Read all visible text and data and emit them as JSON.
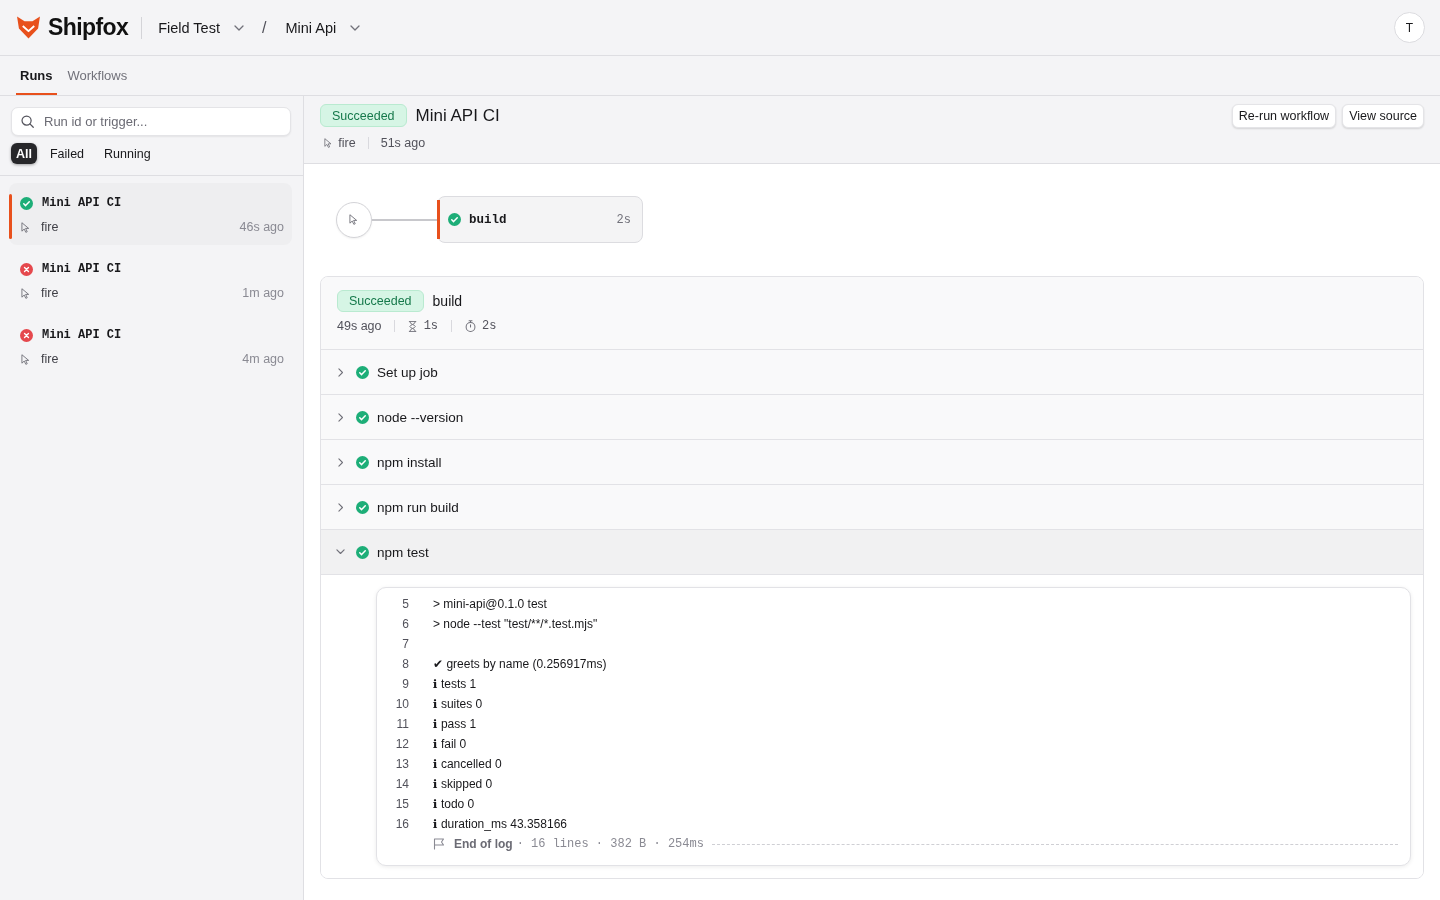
{
  "header": {
    "brand": "Shipfox",
    "breadcrumb": [
      {
        "label": "Field Test"
      },
      {
        "label": "Mini Api"
      }
    ],
    "breadcrumb_separator": "/",
    "avatar": "T"
  },
  "nav_tabs": [
    {
      "label": "Runs",
      "selected": true
    },
    {
      "label": "Workflows",
      "selected": false
    }
  ],
  "sidebar": {
    "search": {
      "placeholder": "Run id or trigger..."
    },
    "filters": [
      {
        "label": "All",
        "selected": true
      },
      {
        "label": "Failed",
        "selected": false
      },
      {
        "label": "Running",
        "selected": false
      }
    ],
    "runs": [
      {
        "title": "Mini API CI",
        "kind": "success",
        "trigger": "fire",
        "time": "46s ago",
        "selected": true
      },
      {
        "title": "Mini API CI",
        "kind": "failure",
        "trigger": "fire",
        "time": "1m ago",
        "selected": false
      },
      {
        "title": "Mini API CI",
        "kind": "failure",
        "trigger": "fire",
        "time": "4m ago",
        "selected": false
      }
    ]
  },
  "run": {
    "kind": "success",
    "status_label": "Succeeded",
    "title": "Mini API CI",
    "trigger": "fire",
    "time": "51s ago",
    "buttons": [
      "Re-run workflow",
      "View source"
    ]
  },
  "graph": {
    "jobs": [
      {
        "name": "build",
        "kind": "success",
        "duration": "2s",
        "selected": true
      }
    ]
  },
  "job": {
    "kind": "success",
    "status_label": "Succeeded",
    "name": "build",
    "time": "49s ago",
    "queued": "1s",
    "duration": "2s",
    "steps": [
      {
        "label": "Set up job",
        "kind": "success",
        "expanded": false
      },
      {
        "label": "node --version",
        "kind": "success",
        "expanded": false
      },
      {
        "label": "npm install",
        "kind": "success",
        "expanded": false
      },
      {
        "label": "npm run build",
        "kind": "success",
        "expanded": false
      },
      {
        "label": "npm test",
        "kind": "success",
        "expanded": true,
        "log": {
          "lines": [
            {
              "number": "5",
              "text": "> mini-api@0.1.0 test"
            },
            {
              "number": "6",
              "text": "> node --test \"test/**/*.test.mjs\""
            },
            {
              "number": "7"
            },
            {
              "number": "8",
              "text": "✔ greets by name (0.256917ms)"
            },
            {
              "number": "9",
              "text": "ℹ tests 1"
            },
            {
              "number": "10",
              "text": "ℹ suites 0"
            },
            {
              "number": "11",
              "text": "ℹ pass 1"
            },
            {
              "number": "12",
              "text": "ℹ fail 0"
            },
            {
              "number": "13",
              "text": "ℹ cancelled 0"
            },
            {
              "number": "14",
              "text": "ℹ skipped 0"
            },
            {
              "number": "15",
              "text": "ℹ todo 0"
            },
            {
              "number": "16",
              "text": "ℹ duration_ms 43.358166"
            }
          ],
          "end_label": "End of log",
          "stats": "· 16 lines · 382 B · 254ms"
        }
      }
    ]
  }
}
